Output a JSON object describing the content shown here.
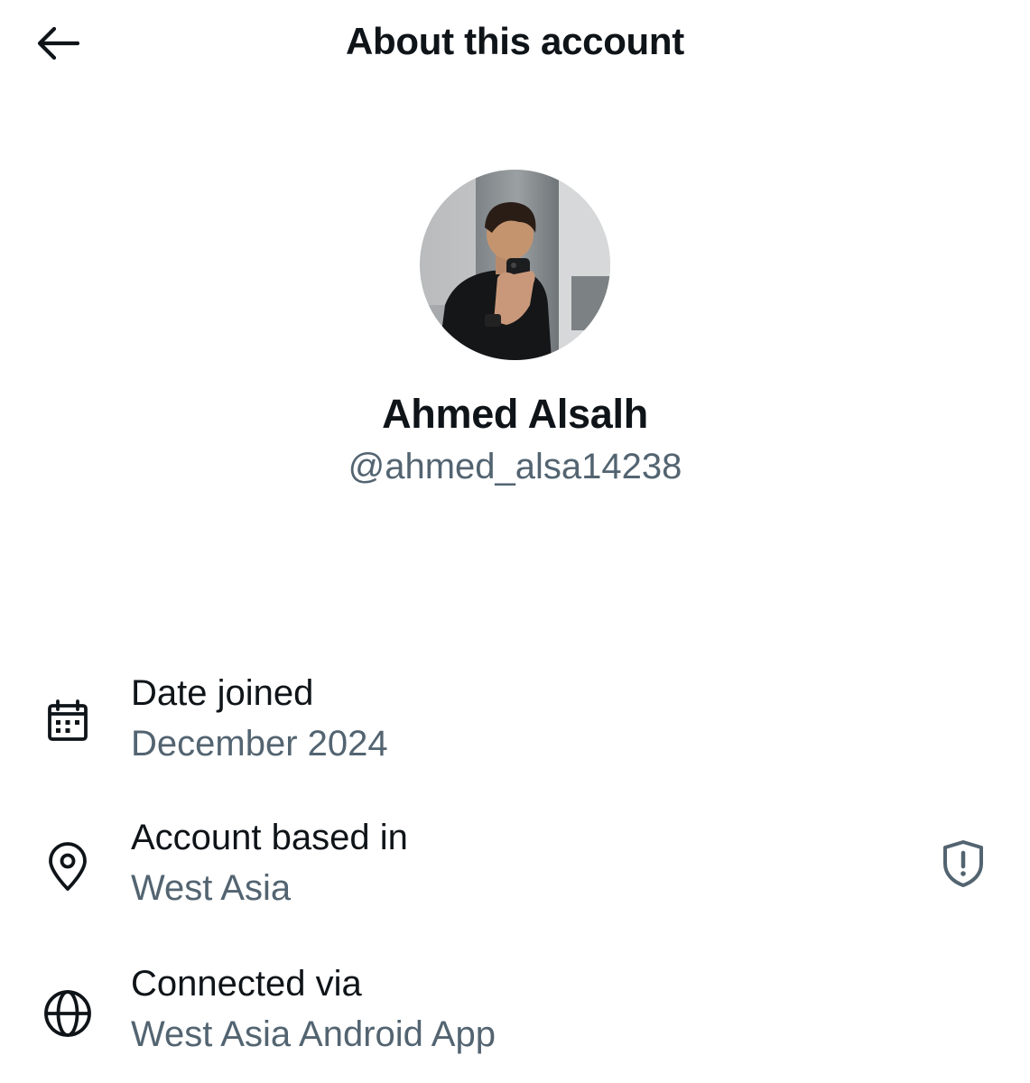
{
  "header": {
    "title": "About this account",
    "back_icon": "arrow-left-icon"
  },
  "profile": {
    "display_name": "Ahmed Alsalh",
    "handle": "@ahmed_alsa14238",
    "avatar_description_icon": "avatar-photo"
  },
  "info": {
    "date_joined": {
      "label": "Date joined",
      "value": "December 2024",
      "icon": "calendar-icon"
    },
    "based_in": {
      "label": "Account based in",
      "value": "West Asia",
      "icon": "location-pin-icon",
      "action_icon": "shield-alert-icon"
    },
    "connected_via": {
      "label": "Connected via",
      "value": "West Asia Android App",
      "icon": "globe-icon"
    }
  },
  "colors": {
    "primary_text": "#0f1419",
    "secondary_text": "#536471",
    "background": "#ffffff"
  }
}
